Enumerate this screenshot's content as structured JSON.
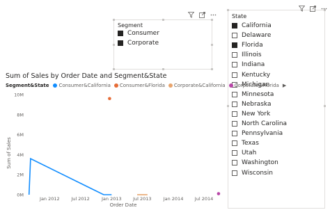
{
  "colors": {
    "consumer_california": "#118DFF",
    "consumer_florida": "#E66C37",
    "corporate_california": "#E8A46C",
    "corporate_florida": "#B845A7"
  },
  "icons": [
    "filter-icon",
    "focus-mode-icon",
    "more-options-icon"
  ],
  "segment_slicer": {
    "title": "Segment",
    "items": [
      {
        "label": "Consumer",
        "checked": true
      },
      {
        "label": "Corporate",
        "checked": true
      }
    ]
  },
  "state_slicer": {
    "title": "State",
    "items": [
      {
        "label": "California",
        "checked": true
      },
      {
        "label": "Delaware",
        "checked": false
      },
      {
        "label": "Florida",
        "checked": true
      },
      {
        "label": "Illinois",
        "checked": false
      },
      {
        "label": "Indiana",
        "checked": false
      },
      {
        "label": "Kentucky",
        "checked": false
      },
      {
        "label": "Michigan",
        "checked": false
      },
      {
        "label": "Minnesota",
        "checked": false
      },
      {
        "label": "Nebraska",
        "checked": false
      },
      {
        "label": "New York",
        "checked": false
      },
      {
        "label": "North Carolina",
        "checked": false
      },
      {
        "label": "Pennsylvania",
        "checked": false
      },
      {
        "label": "Texas",
        "checked": false
      },
      {
        "label": "Utah",
        "checked": false
      },
      {
        "label": "Washington",
        "checked": false
      },
      {
        "label": "Wisconsin",
        "checked": false
      }
    ]
  },
  "legend": {
    "title": "Segment&State",
    "entries": [
      "Consumer&California",
      "Consumer&Florida",
      "Corporate&California",
      "Corporate&Florida"
    ]
  },
  "chart_data": {
    "type": "line",
    "title": "Sum of Sales by Order Date and Segment&State",
    "xlabel": "Order Date",
    "ylabel": "Sum of Sales",
    "x_ticks": [
      "Jan 2012",
      "Jul 2012",
      "Jan 2013",
      "Jul 2013",
      "Jan 2014",
      "Jul 2014"
    ],
    "y_ticks": [
      "10M",
      "8M",
      "6M",
      "4M",
      "2M",
      "0M"
    ],
    "ylim": [
      0,
      10000000
    ],
    "xlim": [
      "2011-08-25",
      "2014-10-20"
    ],
    "grid": false,
    "legend_position": "top-left",
    "series": [
      {
        "name": "Consumer&California",
        "color": "#118DFF",
        "mode": "line",
        "points": [
          [
            "2011-09-01",
            0
          ],
          [
            "2011-09-10",
            3600000
          ],
          [
            "2012-11-15",
            0
          ],
          [
            "2013-01-01",
            0
          ]
        ]
      },
      {
        "name": "Consumer&Florida",
        "color": "#E66C37",
        "mode": "marker",
        "points": [
          [
            "2012-12-20",
            9600000
          ]
        ]
      },
      {
        "name": "Corporate&California",
        "color": "#E8A46C",
        "mode": "line",
        "points": [
          [
            "2013-06-01",
            0
          ],
          [
            "2013-08-01",
            0
          ]
        ]
      },
      {
        "name": "Corporate&Florida",
        "color": "#B845A7",
        "mode": "marker",
        "points": [
          [
            "2014-09-25",
            100000
          ]
        ]
      }
    ]
  }
}
